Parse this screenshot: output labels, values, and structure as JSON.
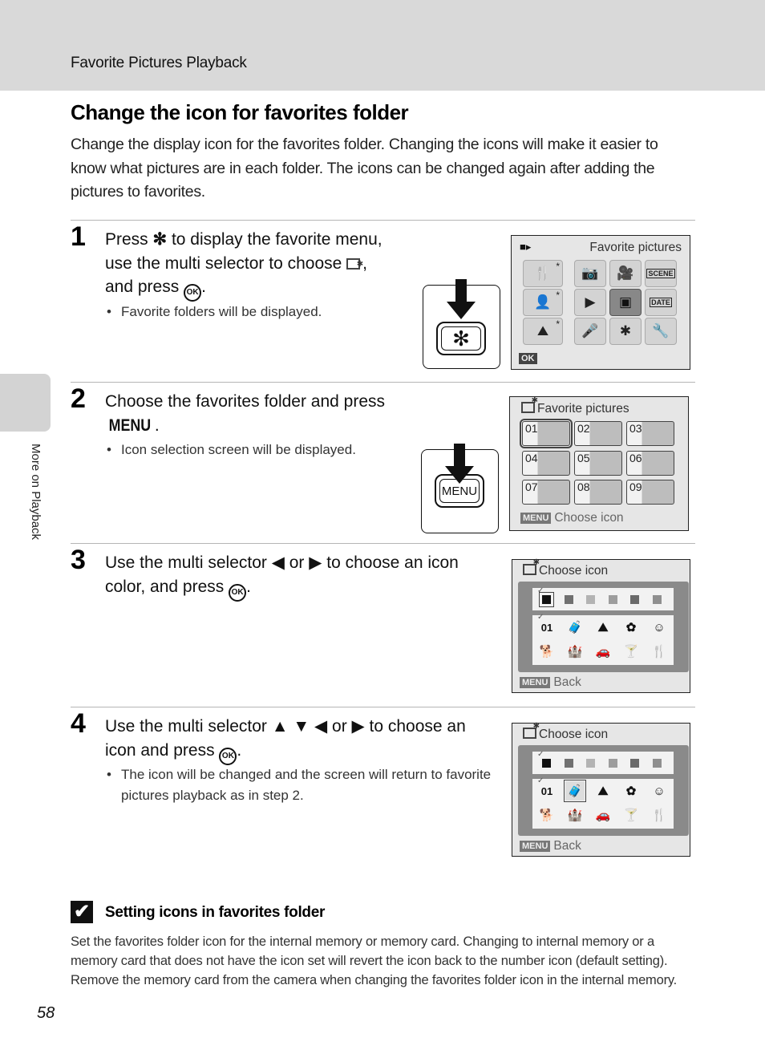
{
  "header": {
    "section_title": "Favorite Pictures Playback"
  },
  "side_tab": {
    "label": "More on Playback"
  },
  "page": {
    "title": "Change the icon for favorites folder",
    "intro": "Change the display icon for the favorites folder. Changing the icons will make it easier to know what pictures are in each folder. The icons can be changed again after adding the pictures to favorites.",
    "page_number": "58"
  },
  "glyphs": {
    "favorite_button": "✻",
    "ok_button": "OK",
    "menu_button": "MENU",
    "left_arrow": "◀",
    "right_arrow": "▶",
    "up_arrow": "▲",
    "down_arrow": "▼"
  },
  "steps": [
    {
      "number": "1",
      "text_parts": [
        "Press ",
        " to display the favorite menu, use the multi selector to choose ",
        ", and press ",
        "."
      ],
      "bullet": "Favorite folders will be displayed.",
      "button_label": "✻"
    },
    {
      "number": "2",
      "text_parts": [
        "Choose the favorites folder and press ",
        "."
      ],
      "bullet": "Icon selection screen will be displayed.",
      "button_label": "MENU"
    },
    {
      "number": "3",
      "text_parts": [
        "Use the multi selector ",
        " or ",
        " to choose an icon color, and press ",
        "."
      ]
    },
    {
      "number": "4",
      "text_parts": [
        "Use the multi selector ",
        " ",
        " ",
        " or ",
        " to choose an icon and press ",
        "."
      ],
      "bullet": "The icon will be changed and the screen will return to favorite pictures playback as in step 2."
    }
  ],
  "screen1": {
    "title": "Favorite pictures",
    "footer_badge": "OK",
    "cells": [
      {
        "icon": "🍴",
        "name": "food-favorite-icon",
        "star": true
      },
      {
        "icon": "📷",
        "name": "camera-mode-icon"
      },
      {
        "icon": "🎥",
        "name": "movie-mode-icon"
      },
      {
        "icon": "SCENE",
        "name": "scene-mode-icon",
        "text": true
      },
      {
        "icon": "👤",
        "name": "portrait-favorite-icon",
        "star": true
      },
      {
        "icon": "▶",
        "name": "playback-icon"
      },
      {
        "icon": "▣",
        "name": "favorite-pictures-icon",
        "selected": true
      },
      {
        "icon": "DATE",
        "name": "list-by-date-icon",
        "text": true
      },
      {
        "icon": "⛰",
        "name": "landscape-favorite-icon",
        "star": true
      },
      {
        "icon": "🎤",
        "name": "voice-recording-icon"
      },
      {
        "icon": "✱",
        "name": "auto-sort-icon"
      },
      {
        "icon": "🔧",
        "name": "setup-icon"
      }
    ]
  },
  "screen2": {
    "title": "Favorite pictures",
    "footer_badge": "MENU",
    "footer_text": "Choose icon",
    "folders": [
      "01",
      "02",
      "03",
      "04",
      "05",
      "06",
      "07",
      "08",
      "09"
    ],
    "selected_index": 0
  },
  "screen3": {
    "title": "Choose icon",
    "footer_badge": "MENU",
    "footer_text": "Back",
    "colors": [
      "#111111",
      "#707070",
      "#b3b3b3",
      "#9d9d9d",
      "#6a6a6a",
      "#8f8f8f"
    ],
    "selected_color_index": 0,
    "icons": [
      {
        "glyph": "01",
        "name": "number-icon"
      },
      {
        "glyph": "🧳",
        "name": "suitcase-icon"
      },
      {
        "glyph": "⛰",
        "name": "mountain-icon"
      },
      {
        "glyph": "✿",
        "name": "flower-icon"
      },
      {
        "glyph": "☺",
        "name": "child-face-icon"
      },
      {
        "glyph": "🐕",
        "name": "dog-icon"
      },
      {
        "glyph": "🏰",
        "name": "castle-icon"
      },
      {
        "glyph": "🚗",
        "name": "car-icon"
      },
      {
        "glyph": "🍸",
        "name": "cocktail-icon"
      },
      {
        "glyph": "🍴",
        "name": "food-icon"
      }
    ],
    "selected_icon_index": -1
  },
  "screen4": {
    "title": "Choose icon",
    "footer_badge": "MENU",
    "footer_text": "Back",
    "selected_icon_index": 1
  },
  "note": {
    "icon": "✔",
    "title": "Setting icons in favorites folder",
    "body": "Set the favorites folder icon for the internal memory or memory card. Changing to internal memory or a memory card that does not have the icon set will revert the icon back to the number icon (default setting). Remove the memory card from the camera when changing the favorites folder icon in the internal memory."
  }
}
